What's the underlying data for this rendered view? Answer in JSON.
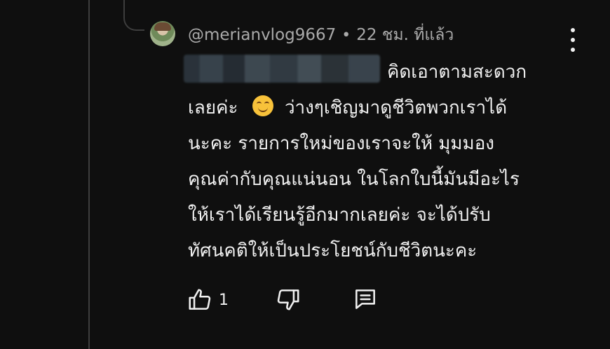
{
  "comment": {
    "author": "@merianvlog9667",
    "separator": "•",
    "time": "22 ชม. ที่แล้ว",
    "text_lines": [
      "คิดเอาตามสะดวก",
      "เลยค่ะ ",
      "ว่างๆเชิญมาดูชีวิตพวกเราได้",
      "นะคะ  รายการใหม่ของเราจะให้ มุมมอง",
      "คุณค่ากับคุณแน่นอน ในโลกใบนี้มันมีอะไร",
      "ให้เราได้เรียนรู้อีกมากเลยค่ะ จะได้ปรับ",
      "ทัศนคติให้เป็นประโยชน์กับชีวิตนะคะ"
    ],
    "emoji": "smiling-face",
    "like_count": "1"
  },
  "icons": {
    "more": "more-vertical-icon",
    "like": "thumbs-up-icon",
    "dislike": "thumbs-down-icon",
    "reply": "comment-reply-icon"
  },
  "colors": {
    "background": "#0f0f0f",
    "text": "#f1f1f1",
    "meta": "#aaaaaa"
  }
}
